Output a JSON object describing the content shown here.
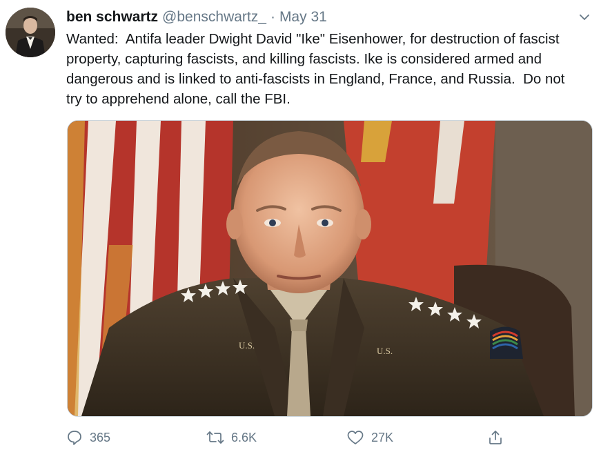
{
  "tweet": {
    "display_name": "ben schwartz",
    "handle": "@benschwartz_",
    "separator": "·",
    "date": "May 31",
    "text": "Wanted:  Antifa leader Dwight David \"Ike\" Eisenhower, for destruction of fascist property, capturing fascists, and killing fascists. Ike is considered armed and dangerous and is linked to anti-fascists in England, France, and Russia.  Do not try to apprehend alone, call the FBI.",
    "media": {
      "image_label": "U.S."
    }
  },
  "actions": {
    "reply_count": "365",
    "retweet_count": "6.6K",
    "like_count": "27K"
  },
  "icons": {
    "reply": "reply-icon",
    "retweet": "retweet-icon",
    "like": "heart-icon",
    "share": "share-icon",
    "menu": "chevron-down-icon"
  },
  "colors": {
    "text": "#14171a",
    "secondary": "#657786",
    "border": "#ccd6dd",
    "background": "#ffffff"
  }
}
